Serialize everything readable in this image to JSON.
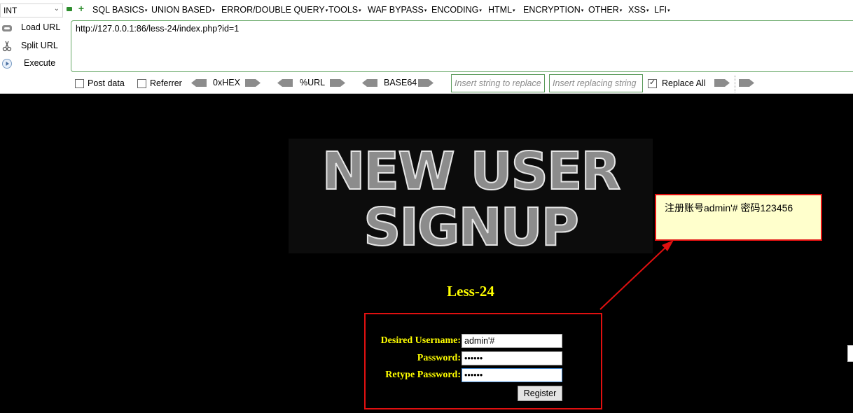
{
  "toolbar": {
    "type_select": "INT",
    "menus": [
      "SQL BASICS",
      "UNION BASED",
      "ERROR/DOUBLE QUERY",
      "TOOLS",
      "WAF BYPASS",
      "ENCODING",
      "HTML",
      "ENCRYPTION",
      "OTHER",
      "XSS",
      "LFI"
    ],
    "load_url": "Load URL",
    "split_url": "Split URL",
    "execute": "Execute",
    "url": "http://127.0.0.1:86/less-24/index.php?id=1",
    "post_data": "Post data",
    "referrer": "Referrer",
    "hex": "0xHEX",
    "url_enc": "%URL",
    "base64": "BASE64",
    "insert_placeholder": "Insert string to replace",
    "replacing_placeholder": "Insert replacing string",
    "replace_all": "Replace All",
    "replace_all_checked": true
  },
  "page": {
    "banner_line1": "NEW USER",
    "banner_line2": "SIGNUP",
    "lesson_title": "Less-24",
    "form": {
      "username_label": "Desired Username:",
      "username_value": "admin'#",
      "password_label": "Password:",
      "password_value": "••••••",
      "retype_label": "Retype Password:",
      "retype_value": "••••••",
      "register_label": "Register"
    },
    "annotation": "注册账号admin'# 密码123456"
  },
  "colors": {
    "title_yellow": "#ffff00",
    "annotation_red": "#e01010",
    "note_bg": "#ffffcc",
    "toolbar_green": "#2d8d2d"
  }
}
